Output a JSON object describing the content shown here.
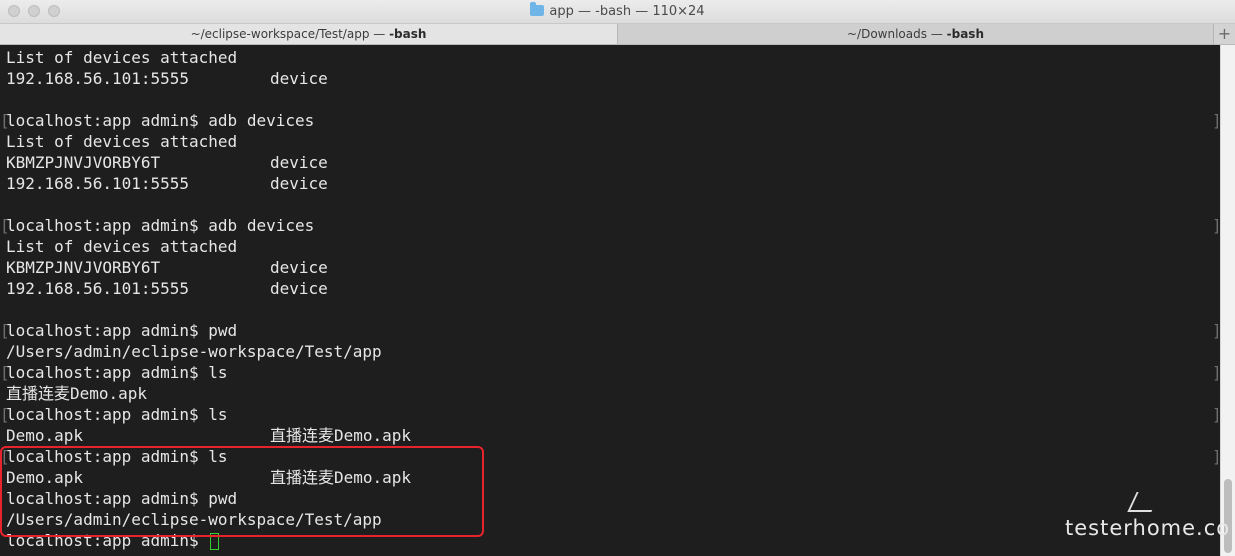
{
  "window": {
    "title": "app — -bash — 110×24",
    "folder_icon": "folder-icon"
  },
  "tabs": [
    {
      "path": "~/eclipse-workspace/Test/app — ",
      "proc": "-bash",
      "active": true
    },
    {
      "path": "~/Downloads — ",
      "proc": "-bash",
      "active": false
    }
  ],
  "new_tab_label": "+",
  "terminal": {
    "lines": [
      {
        "text": "List of devices attached"
      },
      {
        "text": "192.168.56.101:5555",
        "col2": "device"
      },
      {
        "text": ""
      },
      {
        "text": "localhost:app admin$ adb devices",
        "prompt": true
      },
      {
        "text": "List of devices attached"
      },
      {
        "text": "KBMZPJNVJVORBY6T",
        "col2": "device"
      },
      {
        "text": "192.168.56.101:5555",
        "col2": "device"
      },
      {
        "text": ""
      },
      {
        "text": "localhost:app admin$ adb devices",
        "prompt": true
      },
      {
        "text": "List of devices attached"
      },
      {
        "text": "KBMZPJNVJVORBY6T",
        "col2": "device"
      },
      {
        "text": "192.168.56.101:5555",
        "col2": "device"
      },
      {
        "text": ""
      },
      {
        "text": "localhost:app admin$ pwd",
        "prompt": true
      },
      {
        "text": "/Users/admin/eclipse-workspace/Test/app"
      },
      {
        "text": "localhost:app admin$ ls",
        "prompt": true
      },
      {
        "text": "直播连麦Demo.apk"
      },
      {
        "text": "localhost:app admin$ ls",
        "prompt": true
      },
      {
        "text": "Demo.apk",
        "col2": "直播连麦Demo.apk"
      },
      {
        "text": "localhost:app admin$ ls",
        "prompt": true
      },
      {
        "text": "Demo.apk",
        "col2": "直播连麦Demo.apk"
      },
      {
        "text": "localhost:app admin$ pwd"
      },
      {
        "text": "/Users/admin/eclipse-workspace/Test/app"
      },
      {
        "text": "localhost:app admin$ ",
        "cursor": true
      }
    ]
  },
  "watermark": "testerhome.co",
  "colors": {
    "background": "#1e1e1e",
    "text": "#e6e6e6",
    "cursor": "#2fd12f",
    "highlight": "#e8232b"
  }
}
